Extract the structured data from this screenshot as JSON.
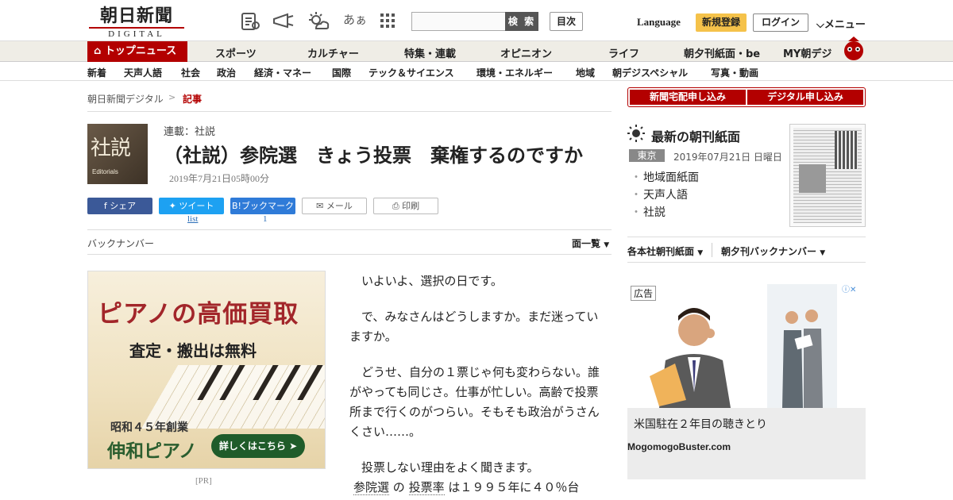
{
  "header": {
    "logo_jp": "朝日新聞",
    "logo_en": "DIGITAL",
    "search_placeholder": "",
    "search_button": "検 索",
    "contents_button": "目次",
    "language": "Language",
    "register": "新規登録",
    "login": "ログイン",
    "menu": "メニュー",
    "font_size_icon_text": "あぁ"
  },
  "nav_primary": {
    "top_news": "トップニュース",
    "items": [
      "スポーツ",
      "カルチャー",
      "特集・連載",
      "オピニオン",
      "ライフ",
      "朝夕刊紙面・be",
      "MY朝デジ"
    ]
  },
  "nav_secondary": {
    "items": [
      "新着",
      "天声人語",
      "社会",
      "政治",
      "経済・マネー",
      "国際",
      "テック＆サイエンス",
      "環境・エネルギー",
      "地域",
      "朝デジスペシャル",
      "写真・動画"
    ]
  },
  "breadcrumb": {
    "home": "朝日新聞デジタル",
    "separator": ">",
    "current": "記事"
  },
  "article": {
    "thumb_kanji": "社説",
    "thumb_en": "Editorials",
    "series": "連載：社説",
    "title": "（社説）参院選　きょう投票　棄権するのですか",
    "date": "2019年7月21日05時00分",
    "paragraphs": [
      "　いよいよ、選択の日です。",
      "　で、みなさんはどうしますか。まだ迷っていますか。",
      "　どうせ、自分の１票じゃ何も変わらない。誰がやっても同じさ。仕事が忙しい。高齢で投票所まで行くのがつらい。そもそも政治がうさんくさい……。",
      "　投票しない理由をよく聞きます。"
    ],
    "last_line": {
      "link1": "参院選",
      "mid1": " の ",
      "link2": "投票率",
      "rest": " は１９９５年に４０％台"
    }
  },
  "share": {
    "facebook": "シェア",
    "twitter": "ツイート",
    "twitter_count": "list",
    "hatena": "B!ブックマーク",
    "hatena_count": "1",
    "mail": "メール",
    "print": "印刷"
  },
  "backnumber": {
    "label": "バックナンバー",
    "list": "面一覧"
  },
  "ad_left": {
    "headline": "ピアノの高価買取",
    "sub": "査定・搬出は無料",
    "year": "昭和４５年創業",
    "company": "伸和ピアノ",
    "button": "詳しくはこちら",
    "pr": "[PR]"
  },
  "sidebar": {
    "btn_home": "新聞宅配申し込み",
    "btn_digital": "デジタル申し込み",
    "morning_title": "最新の朝刊紙面",
    "region": "東京",
    "morning_date": "2019年07月21日 日曜日",
    "links": [
      "地域面紙面",
      "天声人語",
      "社説"
    ],
    "dropdown1": "各本社朝刊紙面",
    "dropdown2": "朝夕刊バックナンバー"
  },
  "ad_right": {
    "label": "広告",
    "caption": "米国駐在２年目の聴きとり",
    "domain": "MogomogoBuster.com"
  },
  "colors": {
    "brand_red": "#b30000",
    "register_yellow": "#f5c24a",
    "facebook": "#3b5998",
    "twitter": "#1da1f2",
    "hatena": "#2f7bd8"
  }
}
